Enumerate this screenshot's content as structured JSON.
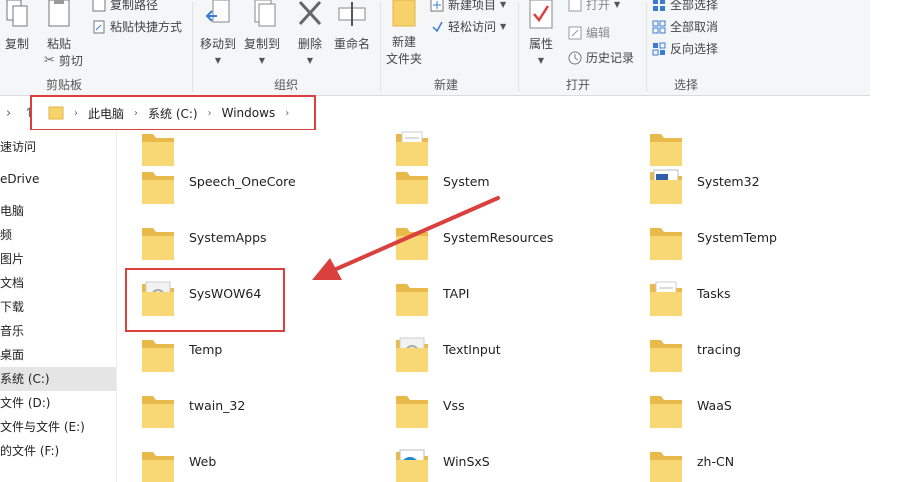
{
  "ribbon": {
    "clipboard": {
      "copy": "复制",
      "paste": "粘贴",
      "copy_path": "复制路径",
      "paste_shortcut": "粘贴快捷方式",
      "cut": "剪切",
      "group": "剪贴板"
    },
    "organize": {
      "move_to": "移动到",
      "copy_to": "复制到",
      "delete": "删除",
      "rename": "重命名",
      "group": "组织"
    },
    "new": {
      "new_folder_line1": "新建",
      "new_folder_line2": "文件夹",
      "new_item": "新建项目",
      "easy_access": "轻松访问",
      "group": "新建"
    },
    "open": {
      "properties": "属性",
      "open": "打开",
      "edit": "编辑",
      "history": "历史记录",
      "group": "打开"
    },
    "select": {
      "select_all": "全部选择",
      "select_none": "全部取消",
      "invert": "反向选择",
      "group": "选择"
    }
  },
  "address": {
    "crumbs": [
      "此电脑",
      "系统 (C:)",
      "Windows"
    ]
  },
  "sidebar": {
    "items": [
      "速访问",
      "eDrive",
      "电脑",
      "频",
      "图片",
      "文档",
      "下载",
      "音乐",
      "桌面",
      "系统 (C:)",
      "文件 (D:)",
      "文件与文件 (E:)",
      "的文件 (F:)"
    ]
  },
  "folders": [
    {
      "name": "",
      "type": "plain"
    },
    {
      "name": "",
      "type": "doc"
    },
    {
      "name": "",
      "type": "plain"
    },
    {
      "name": "Speech_OneCore",
      "type": "plain"
    },
    {
      "name": "System",
      "type": "plain"
    },
    {
      "name": "System32",
      "type": "sys"
    },
    {
      "name": "SystemApps",
      "type": "plain"
    },
    {
      "name": "SystemResources",
      "type": "plain"
    },
    {
      "name": "SystemTemp",
      "type": "plain"
    },
    {
      "name": "SysWOW64",
      "type": "gear"
    },
    {
      "name": "TAPI",
      "type": "plain"
    },
    {
      "name": "Tasks",
      "type": "doc"
    },
    {
      "name": "Temp",
      "type": "plain"
    },
    {
      "name": "TextInput",
      "type": "gear"
    },
    {
      "name": "tracing",
      "type": "plain"
    },
    {
      "name": "twain_32",
      "type": "plain"
    },
    {
      "name": "Vss",
      "type": "plain"
    },
    {
      "name": "WaaS",
      "type": "plain"
    },
    {
      "name": "Web",
      "type": "plain"
    },
    {
      "name": "WinSxS",
      "type": "winsxs"
    },
    {
      "name": "zh-CN",
      "type": "plain"
    }
  ]
}
